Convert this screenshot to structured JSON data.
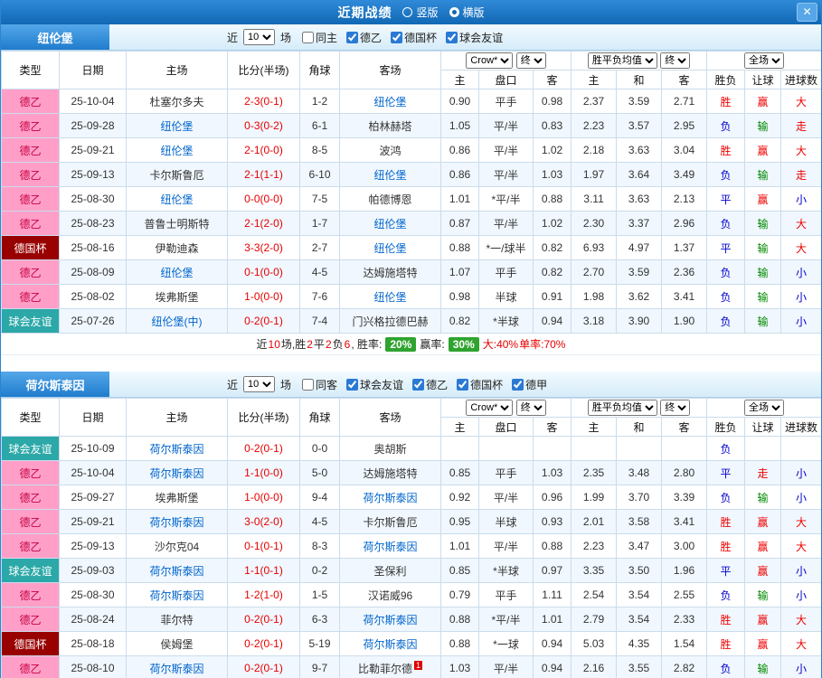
{
  "title_bar": {
    "title": "近期战绩",
    "view_options": [
      {
        "label": "竖版",
        "selected": false
      },
      {
        "label": "横版",
        "selected": true
      }
    ],
    "close": "✕"
  },
  "colors": {
    "titlebar_blue": "#1878c8",
    "league_de2_bg": "#ff9fc8",
    "league_cup_bg": "#990000",
    "league_friendly_bg": "#2ca8a8",
    "win_red": "#f00000",
    "lose_green": "#008800",
    "draw_blue": "#0000cc",
    "rate_badge_green": "#2fa32f",
    "team_link_blue": "#0065cc"
  },
  "sections": [
    {
      "team": "纽伦堡",
      "filter": {
        "prefix": "近",
        "count": "10",
        "suffix": "场",
        "checkboxes": [
          {
            "label": "同主",
            "checked": false
          },
          {
            "label": "德乙",
            "checked": true
          },
          {
            "label": "德国杯",
            "checked": true
          },
          {
            "label": "球会友谊",
            "checked": true
          }
        ]
      },
      "header": {
        "cols": [
          "类型",
          "日期",
          "主场",
          "比分(半场)",
          "角球",
          "客场"
        ],
        "book": "Crow*",
        "final1": "终",
        "avg": "胜平负均值",
        "final2": "终",
        "scope": "全场",
        "sub": [
          "主",
          "盘口",
          "客",
          "主",
          "和",
          "客",
          "胜负",
          "让球",
          "进球数"
        ]
      },
      "rows": [
        {
          "league": "德乙",
          "lcls": "de2",
          "date": "25-10-04",
          "home": "杜塞尔多夫",
          "home_link": false,
          "score": "2-3(0-1)",
          "corners": "1-2",
          "away": "纽伦堡",
          "away_link": true,
          "odds": [
            "0.90",
            "平手",
            "0.98"
          ],
          "avg": [
            "2.37",
            "3.59",
            "2.71"
          ],
          "res": [
            [
              "胜",
              "r"
            ],
            [
              "赢",
              "r"
            ],
            [
              "大",
              "r"
            ]
          ]
        },
        {
          "league": "德乙",
          "lcls": "de2",
          "date": "25-09-28",
          "home": "纽伦堡",
          "home_link": true,
          "score": "0-3(0-2)",
          "corners": "6-1",
          "away": "柏林赫塔",
          "away_link": false,
          "odds": [
            "1.05",
            "平/半",
            "0.83"
          ],
          "avg": [
            "2.23",
            "3.57",
            "2.95"
          ],
          "res": [
            [
              "负",
              "b"
            ],
            [
              "输",
              "g"
            ],
            [
              "走",
              "r"
            ]
          ]
        },
        {
          "league": "德乙",
          "lcls": "de2",
          "date": "25-09-21",
          "home": "纽伦堡",
          "home_link": true,
          "score": "2-1(0-0)",
          "corners": "8-5",
          "away": "波鸿",
          "away_link": false,
          "odds": [
            "0.86",
            "平/半",
            "1.02"
          ],
          "avg": [
            "2.18",
            "3.63",
            "3.04"
          ],
          "res": [
            [
              "胜",
              "r"
            ],
            [
              "赢",
              "r"
            ],
            [
              "大",
              "r"
            ]
          ]
        },
        {
          "league": "德乙",
          "lcls": "de2",
          "date": "25-09-13",
          "home": "卡尔斯鲁厄",
          "home_link": false,
          "score": "2-1(1-1)",
          "corners": "6-10",
          "away": "纽伦堡",
          "away_link": true,
          "odds": [
            "0.86",
            "平/半",
            "1.03"
          ],
          "avg": [
            "1.97",
            "3.64",
            "3.49"
          ],
          "res": [
            [
              "负",
              "b"
            ],
            [
              "输",
              "g"
            ],
            [
              "走",
              "r"
            ]
          ]
        },
        {
          "league": "德乙",
          "lcls": "de2",
          "date": "25-08-30",
          "home": "纽伦堡",
          "home_link": true,
          "score": "0-0(0-0)",
          "corners": "7-5",
          "away": "帕德博恩",
          "away_link": false,
          "odds": [
            "1.01",
            "*平/半",
            "0.88"
          ],
          "avg": [
            "3.11",
            "3.63",
            "2.13"
          ],
          "res": [
            [
              "平",
              "b"
            ],
            [
              "赢",
              "r"
            ],
            [
              "小",
              "b"
            ]
          ]
        },
        {
          "league": "德乙",
          "lcls": "de2",
          "date": "25-08-23",
          "home": "普鲁士明斯特",
          "home_link": false,
          "score": "2-1(2-0)",
          "corners": "1-7",
          "away": "纽伦堡",
          "away_link": true,
          "odds": [
            "0.87",
            "平/半",
            "1.02"
          ],
          "avg": [
            "2.30",
            "3.37",
            "2.96"
          ],
          "res": [
            [
              "负",
              "b"
            ],
            [
              "输",
              "g"
            ],
            [
              "大",
              "r"
            ]
          ]
        },
        {
          "league": "德国杯",
          "lcls": "cup",
          "date": "25-08-16",
          "home": "伊勒迪森",
          "home_link": false,
          "score": "3-3(2-0)",
          "corners": "2-7",
          "away": "纽伦堡",
          "away_link": true,
          "odds": [
            "0.88",
            "*一/球半",
            "0.82"
          ],
          "avg": [
            "6.93",
            "4.97",
            "1.37"
          ],
          "res": [
            [
              "平",
              "b"
            ],
            [
              "输",
              "g"
            ],
            [
              "大",
              "r"
            ]
          ]
        },
        {
          "league": "德乙",
          "lcls": "de2",
          "date": "25-08-09",
          "home": "纽伦堡",
          "home_link": true,
          "score": "0-1(0-0)",
          "corners": "4-5",
          "away": "达姆施塔特",
          "away_link": false,
          "odds": [
            "1.07",
            "平手",
            "0.82"
          ],
          "avg": [
            "2.70",
            "3.59",
            "2.36"
          ],
          "res": [
            [
              "负",
              "b"
            ],
            [
              "输",
              "g"
            ],
            [
              "小",
              "b"
            ]
          ]
        },
        {
          "league": "德乙",
          "lcls": "de2",
          "date": "25-08-02",
          "home": "埃弗斯堡",
          "home_link": false,
          "score": "1-0(0-0)",
          "corners": "7-6",
          "away": "纽伦堡",
          "away_link": true,
          "odds": [
            "0.98",
            "半球",
            "0.91"
          ],
          "avg": [
            "1.98",
            "3.62",
            "3.41"
          ],
          "res": [
            [
              "负",
              "b"
            ],
            [
              "输",
              "g"
            ],
            [
              "小",
              "b"
            ]
          ]
        },
        {
          "league": "球会友谊",
          "lcls": "fr",
          "date": "25-07-26",
          "home": "纽伦堡(中)",
          "home_link": true,
          "score": "0-2(0-1)",
          "corners": "7-4",
          "away": "门兴格拉德巴赫",
          "away_link": false,
          "odds": [
            "0.82",
            "*半球",
            "0.94"
          ],
          "avg": [
            "3.18",
            "3.90",
            "1.90"
          ],
          "res": [
            [
              "负",
              "b"
            ],
            [
              "输",
              "g"
            ],
            [
              "小",
              "b"
            ]
          ]
        }
      ],
      "summary": {
        "parts": [
          {
            "t": "近",
            "c": "k"
          },
          {
            "t": "10",
            "c": "r"
          },
          {
            "t": "场,胜",
            "c": "k"
          },
          {
            "t": "2",
            "c": "r"
          },
          {
            "t": "平",
            "c": "k"
          },
          {
            "t": "2",
            "c": "r"
          },
          {
            "t": "负",
            "c": "k"
          },
          {
            "t": "6",
            "c": "r"
          },
          {
            "t": ", 胜率: ",
            "c": "k"
          },
          {
            "t": "20%",
            "c": "badge"
          },
          {
            "t": " 赢率: ",
            "c": "k"
          },
          {
            "t": "30%",
            "c": "badge"
          },
          {
            "t": " 大:40%",
            "c": "r"
          },
          {
            "t": " 单率:70%",
            "c": "r"
          }
        ]
      }
    },
    {
      "team": "荷尔斯泰因",
      "filter": {
        "prefix": "近",
        "count": "10",
        "suffix": "场",
        "checkboxes": [
          {
            "label": "同客",
            "checked": false
          },
          {
            "label": "球会友谊",
            "checked": true
          },
          {
            "label": "德乙",
            "checked": true
          },
          {
            "label": "德国杯",
            "checked": true
          },
          {
            "label": "德甲",
            "checked": true
          }
        ]
      },
      "header": {
        "cols": [
          "类型",
          "日期",
          "主场",
          "比分(半场)",
          "角球",
          "客场"
        ],
        "book": "Crow*",
        "final1": "终",
        "avg": "胜平负均值",
        "final2": "终",
        "scope": "全场",
        "sub": [
          "主",
          "盘口",
          "客",
          "主",
          "和",
          "客",
          "胜负",
          "让球",
          "进球数"
        ]
      },
      "rows": [
        {
          "league": "球会友谊",
          "lcls": "fr",
          "date": "25-10-09",
          "home": "荷尔斯泰因",
          "home_link": true,
          "score": "0-2(0-1)",
          "corners": "0-0",
          "away": "奥胡斯",
          "away_link": false,
          "odds": [
            "",
            "",
            ""
          ],
          "avg": [
            "",
            "",
            ""
          ],
          "res": [
            [
              "负",
              "b"
            ],
            [
              "",
              ""
            ],
            [
              "",
              ""
            ]
          ]
        },
        {
          "league": "德乙",
          "lcls": "de2",
          "date": "25-10-04",
          "home": "荷尔斯泰因",
          "home_link": true,
          "score": "1-1(0-0)",
          "corners": "5-0",
          "away": "达姆施塔特",
          "away_link": false,
          "odds": [
            "0.85",
            "平手",
            "1.03"
          ],
          "avg": [
            "2.35",
            "3.48",
            "2.80"
          ],
          "res": [
            [
              "平",
              "b"
            ],
            [
              "走",
              "r"
            ],
            [
              "小",
              "b"
            ]
          ]
        },
        {
          "league": "德乙",
          "lcls": "de2",
          "date": "25-09-27",
          "home": "埃弗斯堡",
          "home_link": false,
          "score": "1-0(0-0)",
          "corners": "9-4",
          "away": "荷尔斯泰因",
          "away_link": true,
          "odds": [
            "0.92",
            "平/半",
            "0.96"
          ],
          "avg": [
            "1.99",
            "3.70",
            "3.39"
          ],
          "res": [
            [
              "负",
              "b"
            ],
            [
              "输",
              "g"
            ],
            [
              "小",
              "b"
            ]
          ]
        },
        {
          "league": "德乙",
          "lcls": "de2",
          "date": "25-09-21",
          "home": "荷尔斯泰因",
          "home_link": true,
          "score": "3-0(2-0)",
          "corners": "4-5",
          "away": "卡尔斯鲁厄",
          "away_link": false,
          "odds": [
            "0.95",
            "半球",
            "0.93"
          ],
          "avg": [
            "2.01",
            "3.58",
            "3.41"
          ],
          "res": [
            [
              "胜",
              "r"
            ],
            [
              "赢",
              "r"
            ],
            [
              "大",
              "r"
            ]
          ]
        },
        {
          "league": "德乙",
          "lcls": "de2",
          "date": "25-09-13",
          "home": "沙尔克04",
          "home_link": false,
          "score": "0-1(0-1)",
          "corners": "8-3",
          "away": "荷尔斯泰因",
          "away_link": true,
          "odds": [
            "1.01",
            "平/半",
            "0.88"
          ],
          "avg": [
            "2.23",
            "3.47",
            "3.00"
          ],
          "res": [
            [
              "胜",
              "r"
            ],
            [
              "赢",
              "r"
            ],
            [
              "大",
              "r"
            ]
          ]
        },
        {
          "league": "球会友谊",
          "lcls": "fr",
          "date": "25-09-03",
          "home": "荷尔斯泰因",
          "home_link": true,
          "score": "1-1(0-1)",
          "corners": "0-2",
          "away": "圣保利",
          "away_link": false,
          "odds": [
            "0.85",
            "*半球",
            "0.97"
          ],
          "avg": [
            "3.35",
            "3.50",
            "1.96"
          ],
          "res": [
            [
              "平",
              "b"
            ],
            [
              "赢",
              "r"
            ],
            [
              "小",
              "b"
            ]
          ]
        },
        {
          "league": "德乙",
          "lcls": "de2",
          "date": "25-08-30",
          "home": "荷尔斯泰因",
          "home_link": true,
          "score": "1-2(1-0)",
          "corners": "1-5",
          "away": "汉诺威96",
          "away_link": false,
          "odds": [
            "0.79",
            "平手",
            "1.11"
          ],
          "avg": [
            "2.54",
            "3.54",
            "2.55"
          ],
          "res": [
            [
              "负",
              "b"
            ],
            [
              "输",
              "g"
            ],
            [
              "小",
              "b"
            ]
          ]
        },
        {
          "league": "德乙",
          "lcls": "de2",
          "date": "25-08-24",
          "home": "菲尔特",
          "home_link": false,
          "score": "0-2(0-1)",
          "corners": "6-3",
          "away": "荷尔斯泰因",
          "away_link": true,
          "odds": [
            "0.88",
            "*平/半",
            "1.01"
          ],
          "avg": [
            "2.79",
            "3.54",
            "2.33"
          ],
          "res": [
            [
              "胜",
              "r"
            ],
            [
              "赢",
              "r"
            ],
            [
              "大",
              "r"
            ]
          ]
        },
        {
          "league": "德国杯",
          "lcls": "cup",
          "date": "25-08-18",
          "home": "侯姆堡",
          "home_link": false,
          "score": "0-2(0-1)",
          "corners": "5-19",
          "away": "荷尔斯泰因",
          "away_link": true,
          "odds": [
            "0.88",
            "*一球",
            "0.94"
          ],
          "avg": [
            "5.03",
            "4.35",
            "1.54"
          ],
          "res": [
            [
              "胜",
              "r"
            ],
            [
              "赢",
              "r"
            ],
            [
              "大",
              "r"
            ]
          ]
        },
        {
          "league": "德乙",
          "lcls": "de2",
          "date": "25-08-10",
          "home": "荷尔斯泰因",
          "home_link": true,
          "score": "0-2(0-1)",
          "corners": "9-7",
          "away": "比勒菲尔德",
          "away_link": false,
          "away_badge": "1",
          "odds": [
            "1.03",
            "平/半",
            "0.94"
          ],
          "avg": [
            "2.16",
            "3.55",
            "2.82"
          ],
          "res": [
            [
              "负",
              "b"
            ],
            [
              "输",
              "g"
            ],
            [
              "小",
              "b"
            ]
          ]
        }
      ]
    }
  ]
}
